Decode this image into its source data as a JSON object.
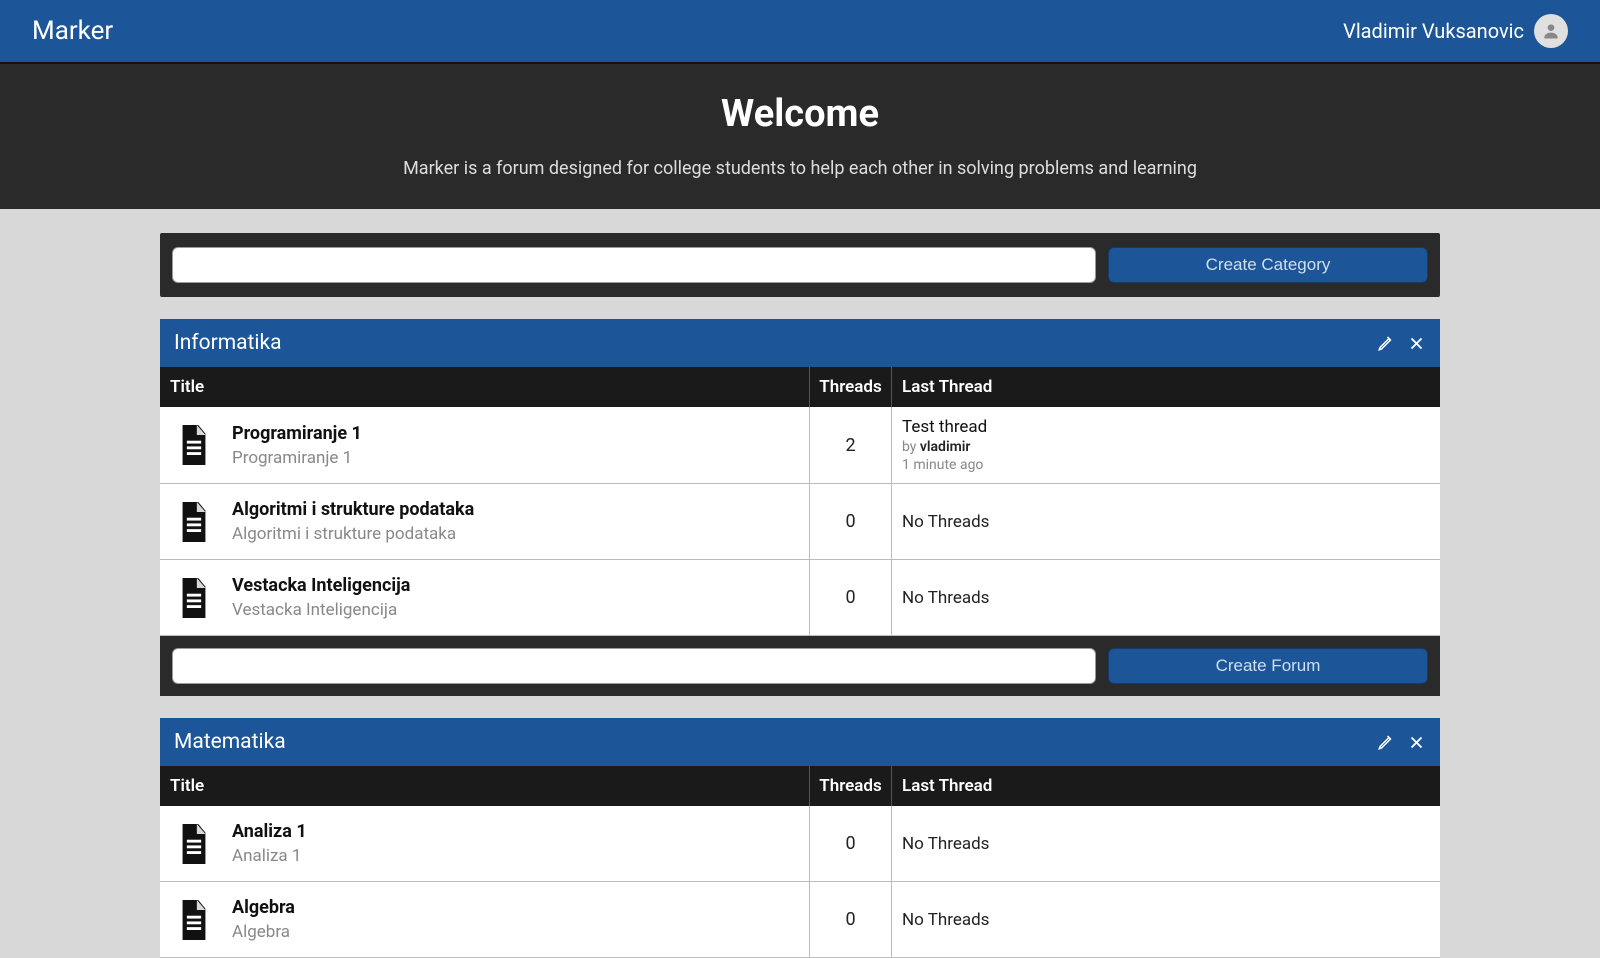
{
  "nav": {
    "brand": "Marker",
    "user": "Vladimir Vuksanovic"
  },
  "hero": {
    "title": "Welcome",
    "subtitle": "Marker is a forum designed for college students to help each other in solving problems and learning"
  },
  "create_category": {
    "button": "Create Category",
    "input_value": ""
  },
  "columns": {
    "title": "Title",
    "threads": "Threads",
    "last": "Last Thread"
  },
  "no_threads": "No Threads",
  "by_label": "by",
  "categories": [
    {
      "name": "Informatika",
      "create_forum_button": "Create Forum",
      "forums": [
        {
          "title": "Programiranje 1",
          "desc": "Programiranje 1",
          "threads": "2",
          "last": {
            "title": "Test thread",
            "author": "vladimir",
            "time": "1 minute ago"
          }
        },
        {
          "title": "Algoritmi i strukture podataka",
          "desc": "Algoritmi i strukture podataka",
          "threads": "0",
          "last": null
        },
        {
          "title": "Vestacka Inteligencija",
          "desc": "Vestacka Inteligencija",
          "threads": "0",
          "last": null
        }
      ]
    },
    {
      "name": "Matematika",
      "create_forum_button": "Create Forum",
      "forums": [
        {
          "title": "Analiza 1",
          "desc": "Analiza 1",
          "threads": "0",
          "last": null
        },
        {
          "title": "Algebra",
          "desc": "Algebra",
          "threads": "0",
          "last": null
        }
      ]
    }
  ]
}
